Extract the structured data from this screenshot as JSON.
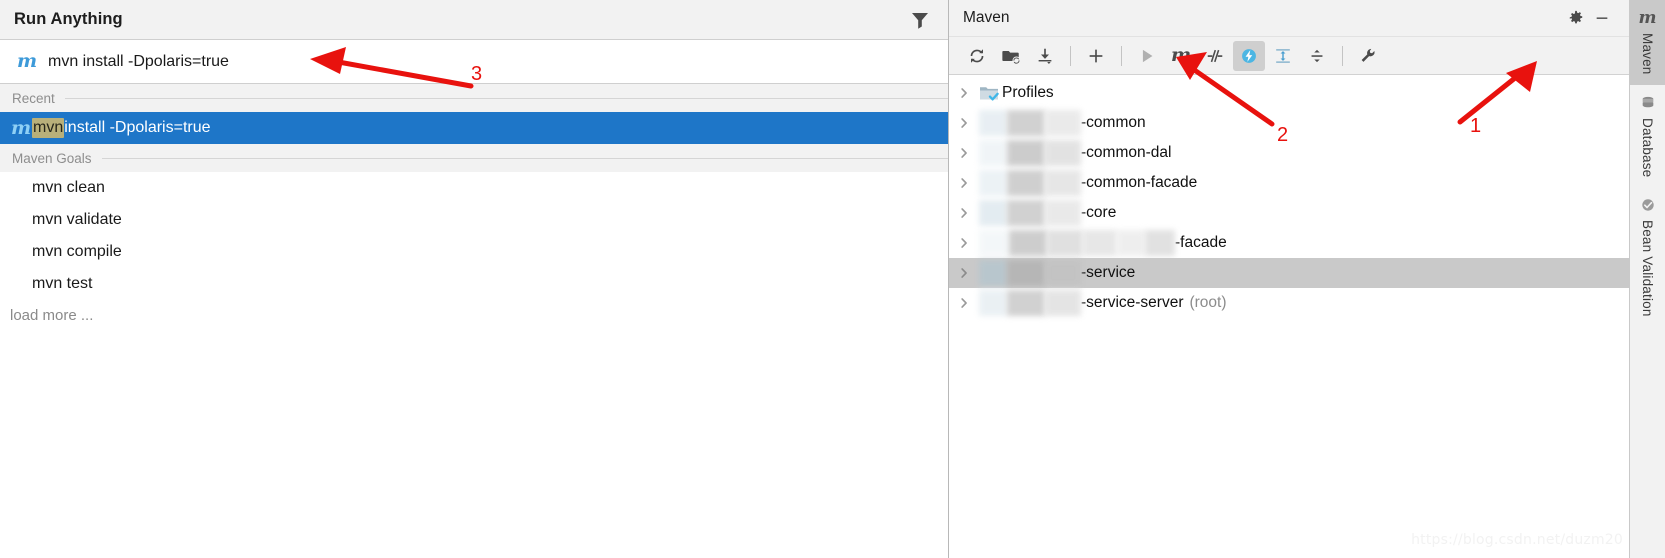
{
  "run_anything": {
    "title": "Run Anything",
    "filter_icon": "filter-icon",
    "input": {
      "icon": "maven-m-icon",
      "value": "mvn install -Dpolaris=true",
      "placeholder": "mvn install -Dpolaris=true"
    },
    "sections": [
      {
        "label": "Recent"
      },
      {
        "label": "Maven Goals"
      }
    ],
    "recent": [
      {
        "icon": "maven-m-icon",
        "match": "mvn",
        "rest": " install -Dpolaris=true",
        "full": "mvn install -Dpolaris=true",
        "selected": true
      }
    ],
    "maven_goals": [
      {
        "label": "mvn clean"
      },
      {
        "label": "mvn validate"
      },
      {
        "label": "mvn compile"
      },
      {
        "label": "mvn test"
      }
    ],
    "load_more": "load more ..."
  },
  "maven_panel": {
    "title": "Maven",
    "title_buttons": [
      {
        "name": "settings-gear-icon",
        "label": ""
      },
      {
        "name": "minimize-icon",
        "label": ""
      }
    ],
    "toolbar": [
      {
        "name": "reload-all-projects-icon",
        "label": "Reload All Maven Projects",
        "active": false
      },
      {
        "name": "add-maven-project-folder-icon",
        "label": "Add Maven Projects",
        "active": false
      },
      {
        "name": "download-sources-icon",
        "label": "Download Sources and/or Documentation",
        "active": false
      },
      {
        "name": "separator",
        "label": "",
        "active": false
      },
      {
        "name": "plus-icon",
        "label": "Add",
        "active": false
      },
      {
        "name": "separator",
        "label": "",
        "active": false
      },
      {
        "name": "run-icon",
        "label": "Run",
        "active": false
      },
      {
        "name": "execute-maven-goal-icon",
        "label": "Execute Maven Goal",
        "active": false
      },
      {
        "name": "toggle-skip-tests-icon",
        "label": "Toggle Skip Tests Mode",
        "active": false
      },
      {
        "name": "toggle-offline-icon",
        "label": "Toggle Offline Mode",
        "active": true
      },
      {
        "name": "expand-all-icon",
        "label": "Expand All",
        "active": false
      },
      {
        "name": "collapse-all-icon",
        "label": "Collapse All",
        "active": false
      },
      {
        "name": "separator",
        "label": "",
        "active": false
      },
      {
        "name": "maven-settings-wrench-icon",
        "label": "Maven Settings",
        "active": false
      }
    ],
    "tree": [
      {
        "name": "profiles-node",
        "icon": "profiles-folder-icon",
        "label": "Profiles",
        "suffix": "",
        "root_tag": "",
        "blurred": false,
        "selected": false
      },
      {
        "name": "module-common",
        "icon": "",
        "label": "",
        "suffix": "-common",
        "root_tag": "",
        "blurred": true,
        "selected": false
      },
      {
        "name": "module-common-dal",
        "icon": "",
        "label": "",
        "suffix": "-common-dal",
        "root_tag": "",
        "blurred": true,
        "selected": false
      },
      {
        "name": "module-common-facade",
        "icon": "",
        "label": "",
        "suffix": "-common-facade",
        "root_tag": "",
        "blurred": true,
        "selected": false
      },
      {
        "name": "module-core",
        "icon": "",
        "label": "",
        "suffix": "-core",
        "root_tag": "",
        "blurred": true,
        "selected": false
      },
      {
        "name": "module-facade",
        "icon": "",
        "label": "",
        "suffix": "-facade",
        "root_tag": "",
        "blurred": true,
        "selected": false
      },
      {
        "name": "module-service",
        "icon": "",
        "label": "",
        "suffix": "-service",
        "root_tag": "",
        "blurred": true,
        "selected": true
      },
      {
        "name": "module-service-server",
        "icon": "",
        "label": "",
        "suffix": "-service-server",
        "root_tag": "(root)",
        "blurred": true,
        "selected": false
      }
    ],
    "watermark": "https://blog.csdn.net/duzm20"
  },
  "side_tabs": [
    {
      "name": "tool-tab-maven",
      "icon": "maven-m-icon",
      "label": "Maven",
      "active": true
    },
    {
      "name": "tool-tab-database",
      "icon": "database-icon",
      "label": "Database",
      "active": false
    },
    {
      "name": "tool-tab-bean-validation",
      "icon": "bean-validation-icon",
      "label": "Bean Validation",
      "active": false
    }
  ],
  "annotations": [
    {
      "number": "1"
    },
    {
      "number": "2"
    },
    {
      "number": "3"
    }
  ],
  "colors": {
    "selection_blue": "#1e76c8",
    "annotation_red": "#e8120e",
    "match_highlight": "#b8b07a",
    "toolbar_bg": "#f2f2f2",
    "tree_selection_gray": "#c9c9c9"
  }
}
